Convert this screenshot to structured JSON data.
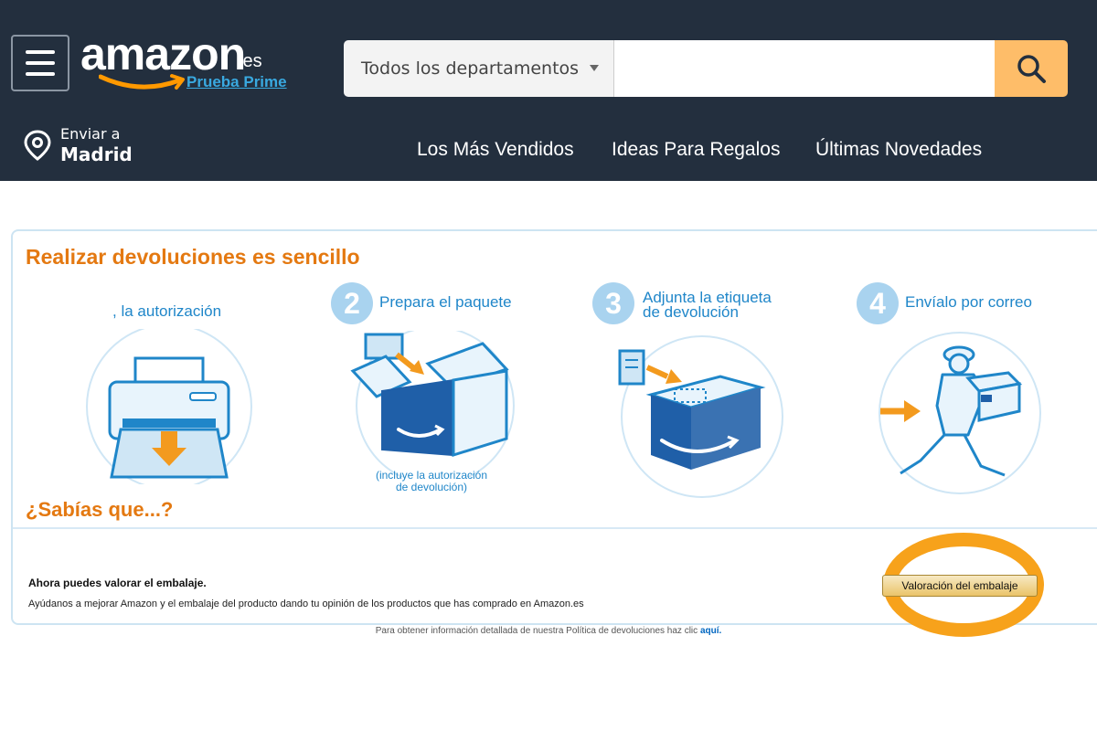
{
  "header": {
    "logo_text": "amazon",
    "logo_suffix": ".es",
    "prime_link": "Prueba Prime",
    "search": {
      "department_label": "Todos los departamentos",
      "query": "",
      "placeholder": ""
    },
    "deliver_to": {
      "line1": "Enviar a",
      "location": "Madrid"
    },
    "nav_links": [
      "Los Más Vendidos",
      "Ideas Para Regalos",
      "Últimas Novedades"
    ]
  },
  "returns": {
    "title": "Realizar devoluciones es sencillo",
    "steps": [
      {
        "number": "",
        "label": "la autorización",
        "note": ""
      },
      {
        "number": "2",
        "label": "Prepara el paquete",
        "note_line1": "(incluye la autorización",
        "note_line2": "de devolución)"
      },
      {
        "number": "3",
        "label_line1": "Adjunta la etiqueta",
        "label_line2": "de devolución"
      },
      {
        "number": "4",
        "label": "Envíalo por correo"
      }
    ]
  },
  "did_you_know": {
    "title": "¿Sabías que...?",
    "heading": "Ahora puedes valorar el embalaje.",
    "text": "Ayúdanos a mejorar Amazon y el embalaje del producto dando tu opinión de los productos que has comprado en Amazon.es",
    "button_label": "Valoración del embalaje"
  },
  "footer": {
    "policy_text": "Para obtener información detallada de nuestra Política de devoluciones haz clic",
    "policy_link": "aquí."
  },
  "colors": {
    "header_bg": "#232f3e",
    "accent_orange": "#e47911",
    "search_button": "#febd69",
    "illustration_blue": "#1f86c9",
    "highlight_ring": "#f7a21b"
  }
}
